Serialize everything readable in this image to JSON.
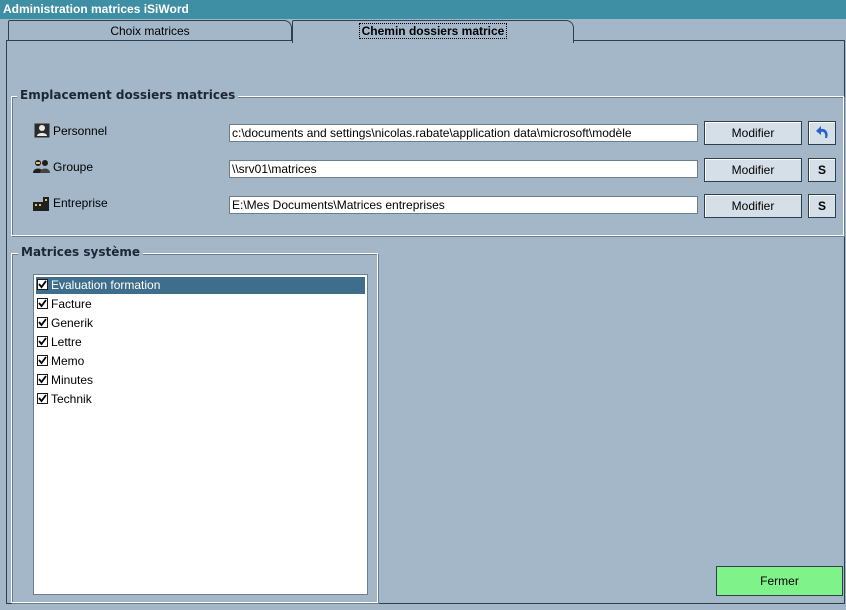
{
  "window": {
    "title": "Administration matrices iSiWord"
  },
  "tabs": [
    {
      "label": "Choix matrices",
      "active": false
    },
    {
      "label": "Chemin dossiers matrice",
      "active": true
    }
  ],
  "locations": {
    "caption": "Emplacement dossiers matrices",
    "rows": [
      {
        "label": "Personnel",
        "icon": "personal-user-icon",
        "path": "c:\\documents and settings\\nicolas.rabate\\application data\\microsoft\\modèle",
        "modify_label": "Modifier",
        "extra_button": "↺",
        "extra_icon": "undo-arrow-icon"
      },
      {
        "label": "Groupe",
        "icon": "group-users-icon",
        "path": "\\\\srv01\\matrices",
        "modify_label": "Modifier",
        "extra_button": "S"
      },
      {
        "label": "Entreprise",
        "icon": "building-icon",
        "path": "E:\\Mes Documents\\Matrices entreprises",
        "modify_label": "Modifier",
        "extra_button": "S"
      }
    ]
  },
  "system_templates": {
    "caption": "Matrices système",
    "items": [
      {
        "label": "Evaluation formation",
        "checked": true,
        "selected": true
      },
      {
        "label": "Facture",
        "checked": true,
        "selected": false
      },
      {
        "label": "Generik",
        "checked": true,
        "selected": false
      },
      {
        "label": "Lettre",
        "checked": true,
        "selected": false
      },
      {
        "label": "Memo",
        "checked": true,
        "selected": false
      },
      {
        "label": "Minutes",
        "checked": true,
        "selected": false
      },
      {
        "label": "Technik",
        "checked": true,
        "selected": false
      }
    ]
  },
  "footer": {
    "close_label": "Fermer"
  },
  "colors": {
    "titlebar": "#3f8fa4",
    "window_bg": "#a3b7c9",
    "selection": "#3f6d8c",
    "close_button": "#7ff28a"
  }
}
